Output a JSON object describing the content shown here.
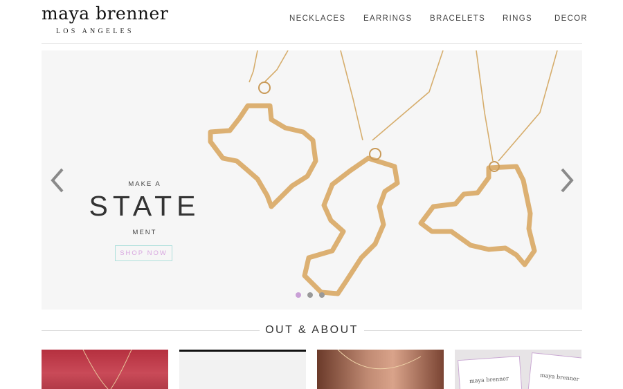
{
  "brand": {
    "name": "maya brenner",
    "city": "LOS ANGELES"
  },
  "nav": {
    "items": [
      "NECKLACES",
      "EARRINGS",
      "BRACELETS",
      "RINGS",
      "DECOR"
    ]
  },
  "hero": {
    "pre_text": "MAKE A",
    "headline": "STATE",
    "post_text": "MENT",
    "cta_label": "SHOP NOW",
    "prev_icon": "chevron-left-icon",
    "next_icon": "chevron-right-icon",
    "slide_count": 3,
    "active_slide": 1,
    "colors": {
      "accent_teal": "#aee0dc",
      "accent_lilac": "#d8a6e0",
      "gold": "#d8b070"
    }
  },
  "section": {
    "title": "OUT & ABOUT"
  },
  "thumbnails": [
    {
      "card_text": ""
    },
    {
      "card_text": ""
    },
    {
      "card_text": ""
    },
    {
      "card_text": "maya brenner"
    }
  ]
}
